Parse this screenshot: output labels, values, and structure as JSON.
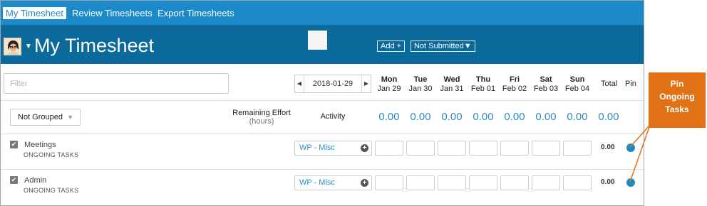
{
  "nav": {
    "tabs": [
      {
        "label": "My Timesheet",
        "active": true
      },
      {
        "label": "Review Timesheets",
        "active": false
      },
      {
        "label": "Export Timesheets",
        "active": false
      }
    ]
  },
  "header": {
    "title": "My Timesheet",
    "add_button": "Add +",
    "status_button": "Not Submitted▼",
    "avatar_icon": "user-avatar",
    "dropdown_icon": "caret-down"
  },
  "filter": {
    "placeholder": "Filter"
  },
  "date_nav": {
    "prev": "◀",
    "next": "▶",
    "value": "2018-01-29"
  },
  "columns": {
    "days": [
      {
        "name": "Mon",
        "date": "Jan 29"
      },
      {
        "name": "Tue",
        "date": "Jan 30"
      },
      {
        "name": "Wed",
        "date": "Jan 31"
      },
      {
        "name": "Thu",
        "date": "Feb 01"
      },
      {
        "name": "Fri",
        "date": "Feb 02"
      },
      {
        "name": "Sat",
        "date": "Feb 03"
      },
      {
        "name": "Sun",
        "date": "Feb 04"
      }
    ],
    "total": "Total",
    "pin": "Pin"
  },
  "grouping": {
    "selected": "Not Grouped",
    "caret": "▼",
    "remaining_label": "Remaining Effort",
    "remaining_unit": "(hours)",
    "activity_label": "Activity",
    "day_totals": [
      "0.00",
      "0.00",
      "0.00",
      "0.00",
      "0.00",
      "0.00",
      "0.00"
    ],
    "grand_total": "0.00"
  },
  "tasks": [
    {
      "name": "Meetings",
      "group": "ONGOING TASKS",
      "activity": "WP - Misc",
      "total": "0.00",
      "checked": true
    },
    {
      "name": "Admin",
      "group": "ONGOING TASKS",
      "activity": "WP - Misc",
      "total": "0.00",
      "checked": true
    }
  ],
  "callout": {
    "text_lines": [
      "Pin",
      "Ongoing",
      "Tasks"
    ]
  },
  "colors": {
    "nav_bg": "#1c8ac8",
    "header_bg": "#0b6a9a",
    "accent": "#2e8dc8",
    "callout": "#e07215"
  }
}
